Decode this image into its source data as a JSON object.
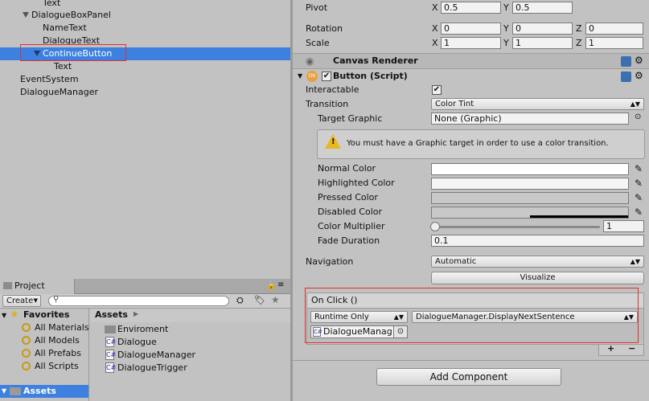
{
  "hierarchy": {
    "items": [
      {
        "label": "Text"
      },
      {
        "label": "DialogueBoxPanel"
      },
      {
        "label": "NameText"
      },
      {
        "label": "DialogueText"
      },
      {
        "label": "ContinueButton"
      },
      {
        "label": "Text"
      },
      {
        "label": "EventSystem"
      },
      {
        "label": "DialogueManager"
      }
    ]
  },
  "project": {
    "tab_label": "Project",
    "create_label": "Create",
    "favorites_label": "Favorites",
    "favorites": [
      "All Materials",
      "All Models",
      "All Prefabs",
      "All Scripts"
    ],
    "assets_root_label": "Assets",
    "breadcrumb_label": "Assets",
    "assets": [
      {
        "label": "Enviroment",
        "type": "folder"
      },
      {
        "label": "Dialogue",
        "type": "script"
      },
      {
        "label": "DialogueManager",
        "type": "script"
      },
      {
        "label": "DialogueTrigger",
        "type": "script"
      }
    ]
  },
  "inspector": {
    "pivot": {
      "label": "Pivot",
      "x_label": "X",
      "x": "0.5",
      "y_label": "Y",
      "y": "0.5"
    },
    "rotation": {
      "label": "Rotation",
      "x_label": "X",
      "x": "0",
      "y_label": "Y",
      "y": "0",
      "z_label": "Z",
      "z": "0"
    },
    "scale": {
      "label": "Scale",
      "x_label": "X",
      "x": "1",
      "y_label": "Y",
      "y": "1",
      "z_label": "Z",
      "z": "1"
    },
    "canvas_renderer_title": "Canvas Renderer",
    "button_component_title": "Button (Script)",
    "ok_badge": "OK",
    "interactable_label": "Interactable",
    "transition_label": "Transition",
    "transition_value": "Color Tint",
    "target_graphic_label": "Target Graphic",
    "target_graphic_value": "None (Graphic)",
    "warning_text": "You must have a Graphic target in order to use a color transition.",
    "normal_color_label": "Normal Color",
    "highlighted_color_label": "Highlighted Color",
    "pressed_color_label": "Pressed Color",
    "disabled_color_label": "Disabled Color",
    "color_multiplier_label": "Color Multiplier",
    "color_multiplier_value": "1",
    "fade_duration_label": "Fade Duration",
    "fade_duration_value": "0.1",
    "navigation_label": "Navigation",
    "navigation_value": "Automatic",
    "visualize_label": "Visualize",
    "on_click_label": "On Click ()",
    "runtime_value": "Runtime Only",
    "function_value": "DialogueManager.DisplayNextSentence",
    "object_value": "DialogueManag",
    "plus_label": "+",
    "minus_label": "−",
    "add_component_label": "Add Component"
  },
  "colors": {
    "selection": "#3d80df",
    "highlight_box": "#e03030",
    "panel_bg": "#c2c2c2"
  }
}
